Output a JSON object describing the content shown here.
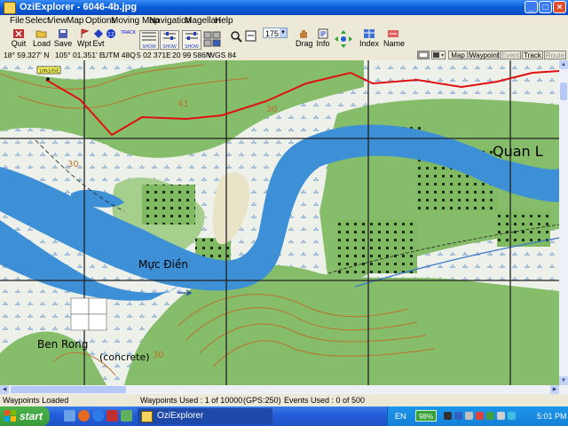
{
  "window": {
    "title": "OziExplorer - 6046-4b.jpg"
  },
  "menu": [
    "File",
    "Select",
    "View",
    "Map",
    "Options",
    "Moving Map",
    "Navigation",
    "Magellan",
    "Help"
  ],
  "toolbar": {
    "quit": "Quit",
    "load": "Load",
    "save": "Save",
    "wpt": "Wpt",
    "evt": "Evt",
    "track": "TRACK",
    "show1": "SHOW",
    "show2": "SHOW",
    "show3": "SHOW",
    "zoom_value": "175",
    "drag": "Drag",
    "info": "Info",
    "index": "Index",
    "name": "Name"
  },
  "coords": {
    "lat": "18° 59.327' N",
    "lon": "105° 01.351' E",
    "utm": "UTM  48Q",
    "easting": "5 02 371E",
    "northing": "20 99 586N",
    "datum": "WGS 84"
  },
  "view_buttons": [
    "Map",
    "Waypoint",
    "Event",
    "Track",
    "Route"
  ],
  "map": {
    "place_labels": [
      "Quan L",
      "Mực Điền",
      "Ben Rong",
      "(concrete)"
    ],
    "contour_labels": [
      "41",
      "30",
      "30",
      "30"
    ],
    "waypoint_label": "10N105E"
  },
  "statusbar": {
    "loaded": "Waypoints Loaded",
    "waypoints_used": "Waypoints Used : 1 of 10000",
    "gps": "(GPS:250)",
    "events_used": "Events Used : 0 of 500"
  },
  "taskbar": {
    "start": "start",
    "app": "OziExplorer",
    "lang": "EN",
    "battery": "98%",
    "time": "5:01 PM"
  },
  "colors": {
    "title_blue": "#0a5fd8",
    "river": "#3d8fd6",
    "forest": "#86bd6a",
    "contour": "#b8732f",
    "track_red": "#e01010",
    "grid": "#222222"
  }
}
